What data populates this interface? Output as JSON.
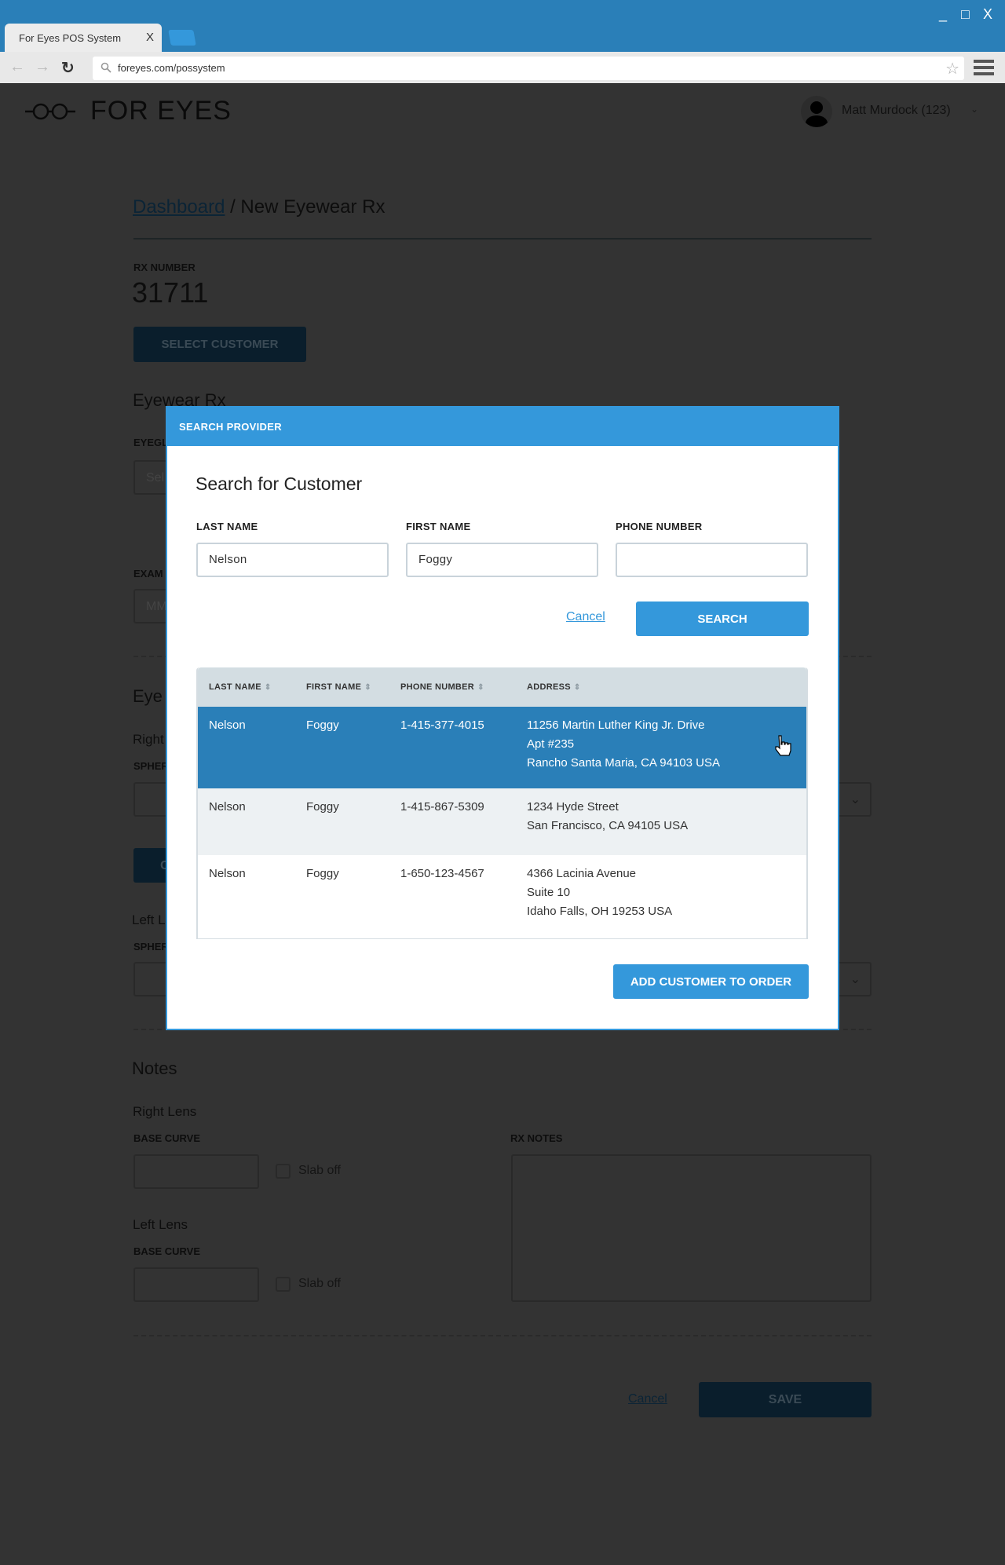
{
  "browser": {
    "tab_title": "For Eyes POS System",
    "tab_close": "X",
    "url": "foreyes.com/possystem",
    "minimize": "_",
    "maximize": "□",
    "close": "X"
  },
  "app": {
    "logo": "FOR EYES",
    "user": "Matt Murdock (123)"
  },
  "page": {
    "breadcrumb_link": "Dashboard",
    "breadcrumb_current": " / New Eyewear Rx",
    "rx_label": "RX NUMBER",
    "rx_number": "31711",
    "select_customer": "SELECT CUSTOMER",
    "eyewear_heading": "Eyewear Rx",
    "eyeglass_label": "EYEGL",
    "eyeglass_placeholder": "Sel",
    "exam_label": "EXAM",
    "exam_placeholder": "MM",
    "eye_heading": "Eye",
    "right_label": "Right",
    "sphere_label": "SPHER",
    "btn_fragment": "C",
    "left_label": "Left L",
    "notes_heading": "Notes",
    "right_lens": "Right Lens",
    "left_lens": "Left Lens",
    "base_curve": "BASE CURVE",
    "slab_off": "Slab off",
    "rx_notes": "RX NOTES",
    "cancel": "Cancel",
    "save": "SAVE"
  },
  "modal": {
    "header": "SEARCH PROVIDER",
    "title": "Search for Customer",
    "fields": [
      {
        "label": "LAST NAME",
        "value": "Nelson"
      },
      {
        "label": "FIRST NAME",
        "value": "Foggy"
      },
      {
        "label": "PHONE NUMBER",
        "value": ""
      }
    ],
    "cancel": "Cancel",
    "search": "SEARCH",
    "columns": [
      "LAST NAME",
      "FIRST NAME",
      "PHONE NUMBER",
      "ADDRESS"
    ],
    "rows": [
      {
        "last": "Nelson",
        "first": "Foggy",
        "phone": "1-415-377-4015",
        "address": [
          "11256 Martin Luther King Jr. Drive",
          "Apt #235",
          "Rancho Santa Maria, CA 94103 USA"
        ],
        "selected": true
      },
      {
        "last": "Nelson",
        "first": "Foggy",
        "phone": "1-415-867-5309",
        "address": [
          "1234 Hyde Street",
          "San Francisco, CA 94105 USA"
        ],
        "selected": false
      },
      {
        "last": "Nelson",
        "first": "Foggy",
        "phone": "1-650-123-4567",
        "address": [
          "4366 Lacinia Avenue",
          "Suite 10",
          "Idaho Falls, OH 19253 USA"
        ],
        "selected": false
      }
    ],
    "add_button": "ADD CUSTOMER TO ORDER"
  },
  "colors": {
    "accent": "#3498db",
    "selected_row": "#2a7fb8",
    "titlebar": "#2a7fb8",
    "header_row": "#d3dde2",
    "alt_row": "#edf1f3"
  }
}
